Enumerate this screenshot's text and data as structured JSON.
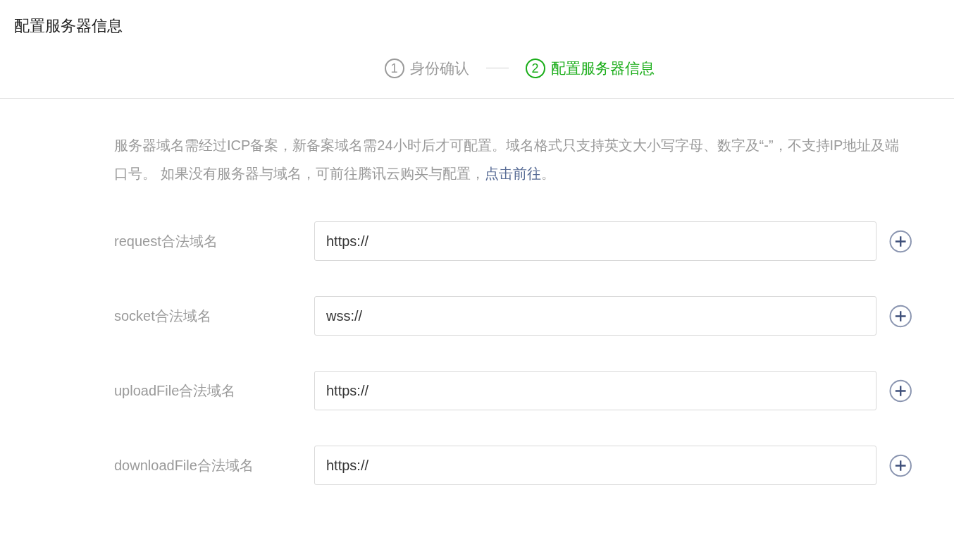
{
  "page_title": "配置服务器信息",
  "steps": [
    {
      "number": "1",
      "label": "身份确认",
      "selected": false
    },
    {
      "number": "2",
      "label": "配置服务器信息",
      "selected": true
    }
  ],
  "notice": {
    "text": "服务器域名需经过ICP备案，新备案域名需24小时后才可配置。域名格式只支持英文大小写字母、数字及“-”，不支持IP地址及端口号。 如果没有服务器与域名，可前往腾讯云购买与配置，",
    "link": "点击前往",
    "suffix": "。"
  },
  "fields": [
    {
      "label": "request合法域名",
      "value": "https://"
    },
    {
      "label": "socket合法域名",
      "value": "wss://"
    },
    {
      "label": "uploadFile合法域名",
      "value": "https://"
    },
    {
      "label": "downloadFile合法域名",
      "value": "https://"
    }
  ]
}
